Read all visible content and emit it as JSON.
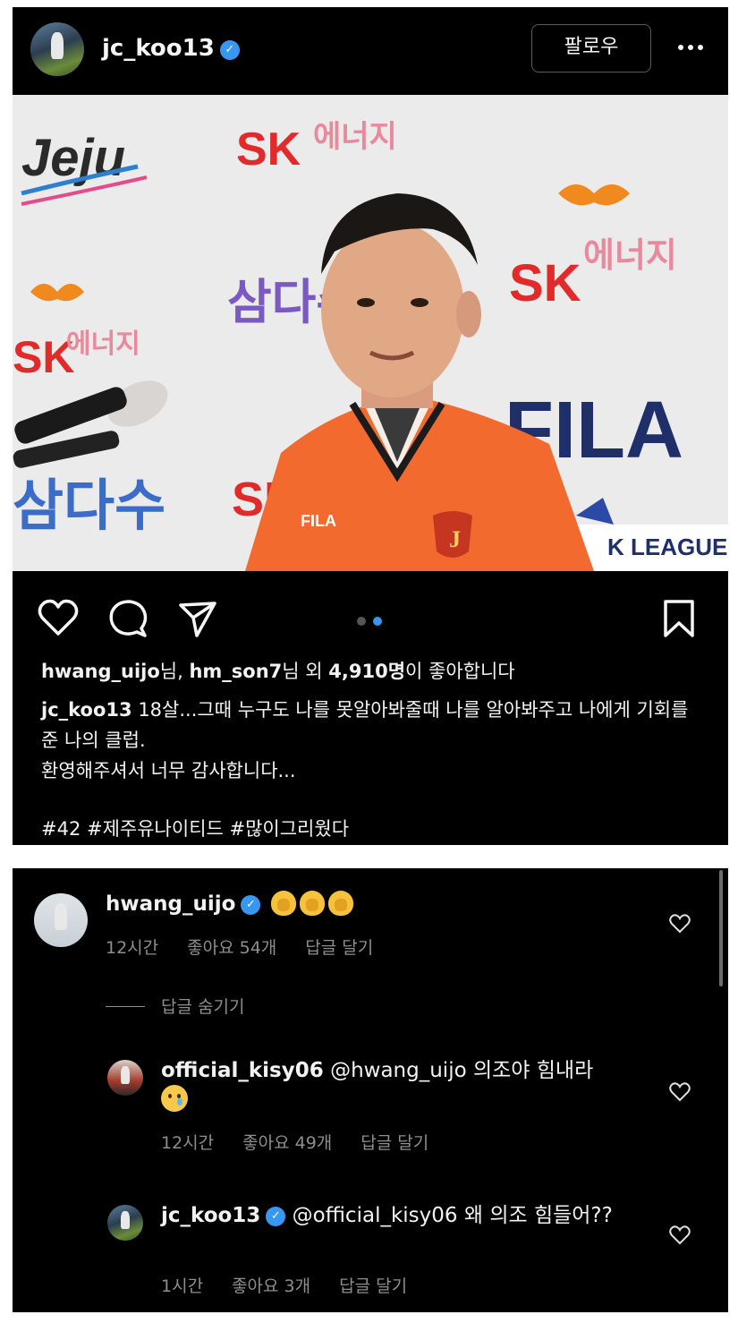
{
  "post": {
    "username": "jc_koo13",
    "follow_label": "팔로우",
    "carousel": {
      "count": 2,
      "active_index": 2
    },
    "likes": {
      "user1": "hwang_uijo",
      "sep1": "님, ",
      "user2": "hm_son7",
      "sep2": "님 외 ",
      "count": "4,910명",
      "suffix": "이 좋아합니다"
    },
    "caption": {
      "author": "jc_koo13",
      "line1": " 18살...그때 누구도 나를 못알아봐줄때 나를 알아봐주고 나에게 기회를 준 나의 클럽.",
      "line2": "환영해주셔서 너무 감사합니다...",
      "hashtags": "#42 #제주유나이티드 #많이그리웠다"
    },
    "photo_signage": {
      "jeju": "Jeju",
      "sk": "SK",
      "energy": "에너지",
      "fila": "FILA",
      "kleague": "K LEAGUE",
      "samdasoo": "삼다수",
      "brand_chest": "FILA"
    }
  },
  "comments": [
    {
      "username": "hwang_uijo",
      "verified": true,
      "text": "",
      "time": "12시간",
      "likes": "좋아요 54개",
      "reply": "답글 달기"
    },
    {
      "username": "official_kisy06",
      "verified": false,
      "text_mention": "@hwang_uijo",
      "text": " 의조야 힘내라",
      "time": "12시간",
      "likes": "좋아요 49개",
      "reply": "답글 달기"
    },
    {
      "username": "jc_koo13",
      "verified": true,
      "text_mention": "@official_kisy06",
      "text": " 왜 의조 힘들어??",
      "time": "1시간",
      "likes": "좋아요 3개",
      "reply": "답글 달기"
    }
  ],
  "hide_replies_label": "답글 숨기기",
  "icons": [
    "heart-icon",
    "comment-icon",
    "share-icon",
    "bookmark-icon",
    "more-icon",
    "verified-icon"
  ],
  "colors": {
    "verified": "#3897f0",
    "background": "#000000",
    "muted": "#8e8e8e",
    "jersey": "#f26a2e"
  }
}
